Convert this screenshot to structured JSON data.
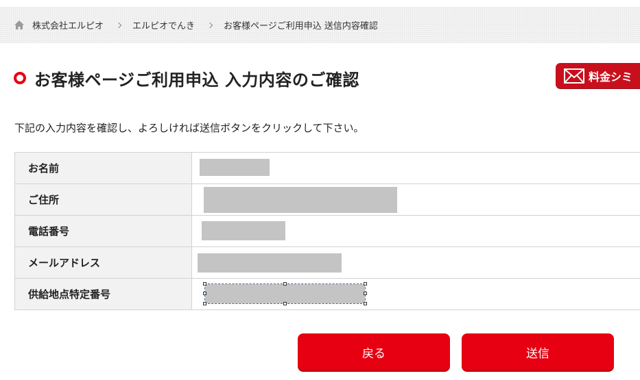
{
  "breadcrumb": {
    "home_icon": "home-icon",
    "items": [
      "株式会社エルピオ",
      "エルピオでんき",
      "お客様ページご利用申込 送信内容確認"
    ]
  },
  "header": {
    "title": "お客様ページご利用申込 入力内容のご確認",
    "title_marker_color": "#e60012"
  },
  "simulation_button": {
    "icon": "mail-icon",
    "label": "料金シミ"
  },
  "instruction": "下記の入力内容を確認し、よろしければ送信ボタンをクリックして下さい。",
  "table": {
    "rows": [
      {
        "label": "お名前",
        "value": ""
      },
      {
        "label": "ご住所",
        "value": ""
      },
      {
        "label": "電話番号",
        "value": ""
      },
      {
        "label": "メールアドレス",
        "value": ""
      },
      {
        "label": "供給地点特定番号",
        "value": ""
      }
    ]
  },
  "actions": {
    "back_label": "戻る",
    "submit_label": "送信",
    "accent_color": "#e60012"
  }
}
